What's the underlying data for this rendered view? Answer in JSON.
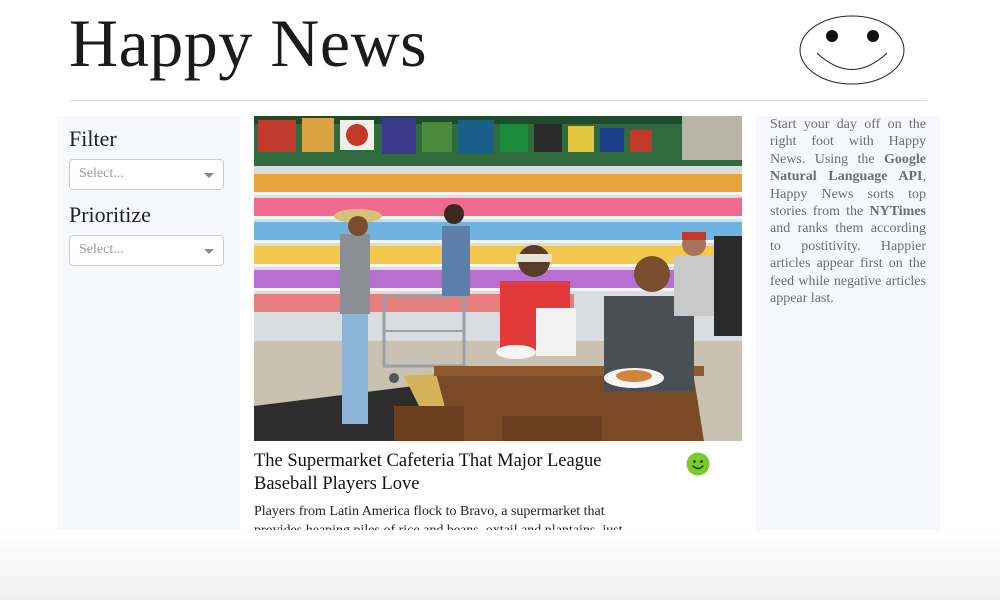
{
  "header": {
    "title": "Happy News",
    "logo_icon": "smiley-face-icon"
  },
  "sidebar": {
    "filter_label": "Filter",
    "filter_placeholder": "Select...",
    "prioritize_label": "Prioritize",
    "prioritize_placeholder": "Select..."
  },
  "article": {
    "headline": "The Supermarket Cafeteria That Major League Baseball Players Love",
    "summary": "Players from Latin America flock to Bravo, a supermarket that provides heaping piles of rice and beans, oxtail and plantains, just",
    "sentiment_icon": "green-smiley-icon",
    "sentiment_color": "#7cc92a"
  },
  "about": {
    "part1": "Start your day off on the right foot with Happy News. Using the ",
    "bold1": "Google Natural Language API",
    "part2": ", Happy News sorts top stories from the ",
    "bold2": "NYTimes",
    "part3": " and ranks them according to postitivity. Happier articles appear first on the feed while negative articles appear last."
  }
}
